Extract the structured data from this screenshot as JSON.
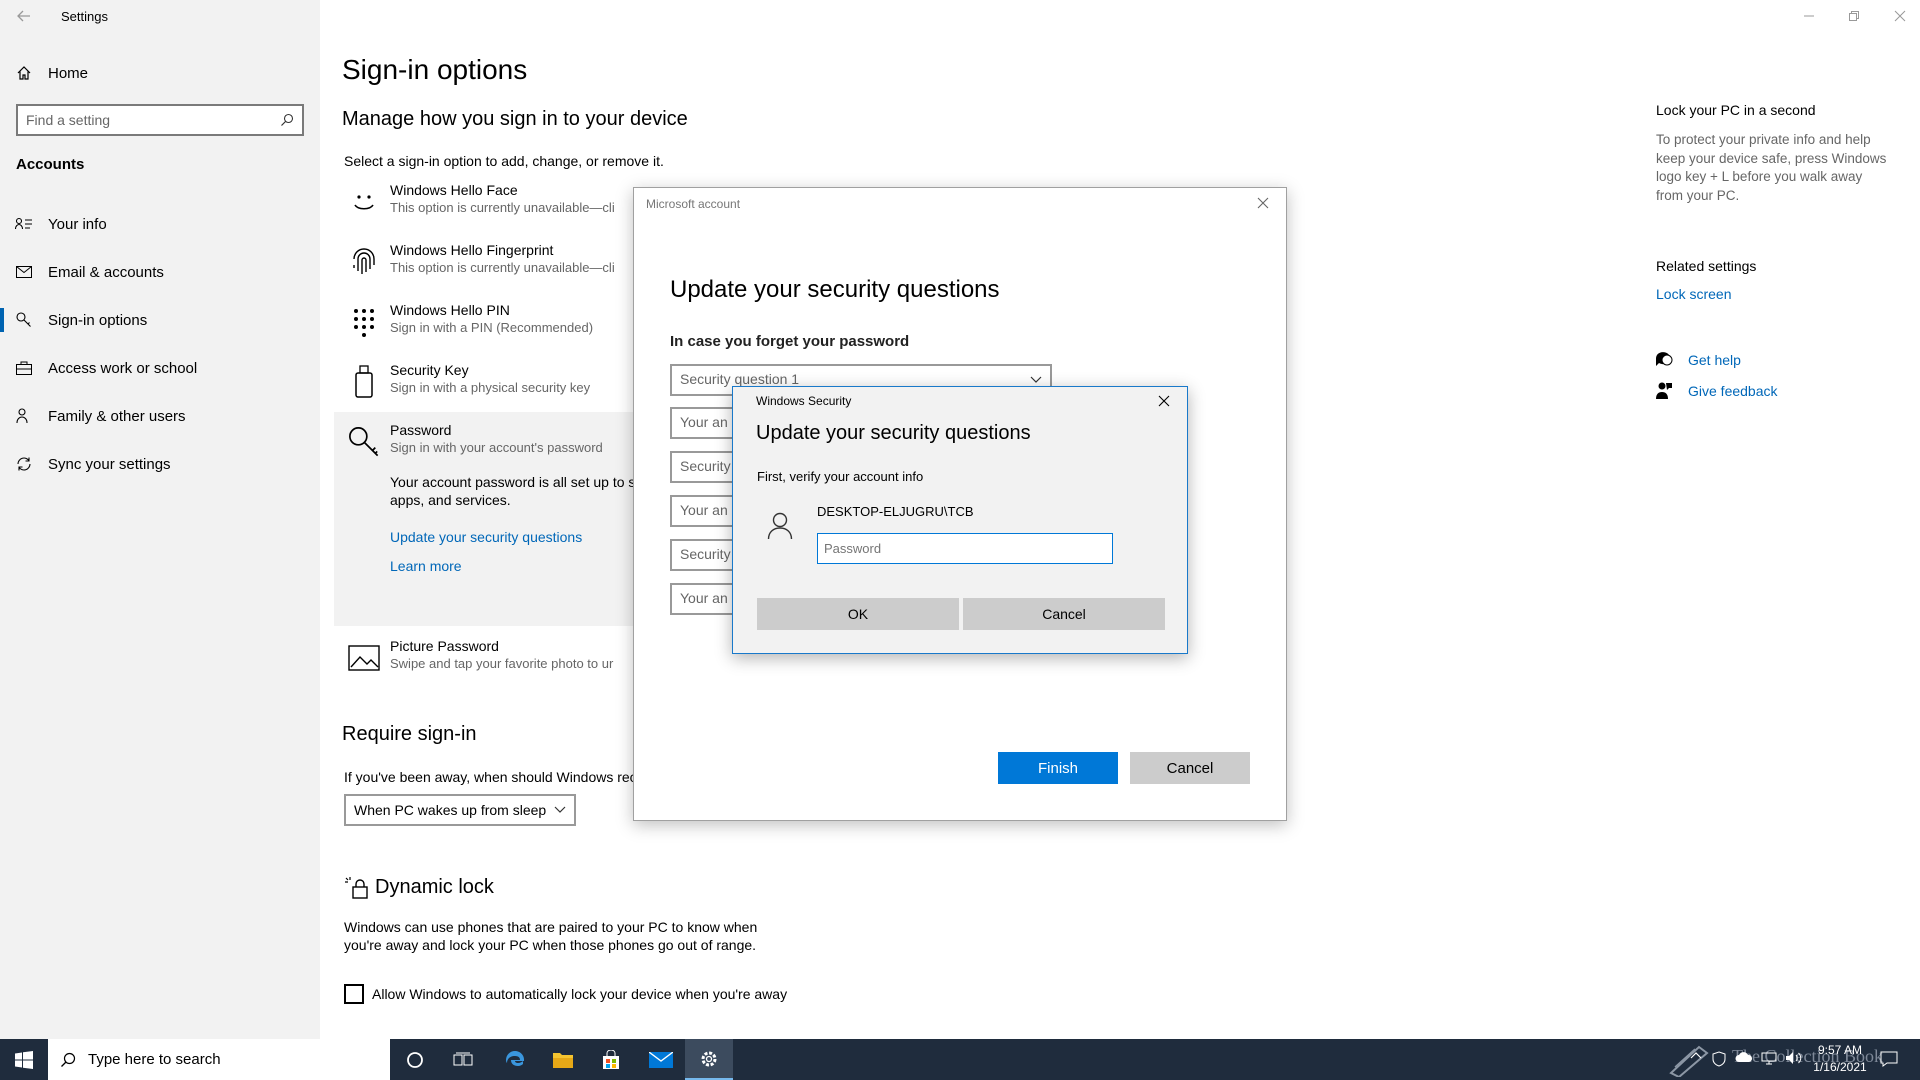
{
  "window": {
    "title": "Settings"
  },
  "sidebar": {
    "home_label": "Home",
    "search_placeholder": "Find a setting",
    "section_title": "Accounts",
    "items": [
      {
        "label": "Your info",
        "icon": "person-card-icon"
      },
      {
        "label": "Email & accounts",
        "icon": "mail-icon"
      },
      {
        "label": "Sign-in options",
        "icon": "key-icon",
        "selected": true
      },
      {
        "label": "Access work or school",
        "icon": "briefcase-icon"
      },
      {
        "label": "Family & other users",
        "icon": "people-icon"
      },
      {
        "label": "Sync your settings",
        "icon": "sync-icon"
      }
    ]
  },
  "main": {
    "title": "Sign-in options",
    "subtitle": "Manage how you sign in to your device",
    "instruction": "Select a sign-in option to add, change, or remove it.",
    "options": [
      {
        "title": "Windows Hello Face",
        "sub": "This option is currently unavailable—cli",
        "icon": "face-icon"
      },
      {
        "title": "Windows Hello Fingerprint",
        "sub": "This option is currently unavailable—cli",
        "icon": "fingerprint-icon"
      },
      {
        "title": "Windows Hello PIN",
        "sub": "Sign in with a PIN (Recommended)",
        "icon": "pin-keypad-icon"
      },
      {
        "title": "Security Key",
        "sub": "Sign in with a physical security key",
        "icon": "usb-key-icon"
      },
      {
        "title": "Password",
        "sub": "Sign in with your account's password",
        "icon": "password-key-icon"
      }
    ],
    "password_detail_line1": "Your account password is all set up to si",
    "password_detail_line2": "apps, and services.",
    "update_security_link": "Update your security questions",
    "learn_more_link": "Learn more",
    "picture_password": {
      "title": "Picture Password",
      "sub": "Swipe and tap your favorite photo to ur"
    },
    "require_signin": {
      "heading": "Require sign-in",
      "text": "If you've been away, when should Windows rec",
      "dropdown_value": "When PC wakes up from sleep"
    },
    "dynamic_lock": {
      "heading": "Dynamic lock",
      "text_line1": "Windows can use phones that are paired to your PC to know when",
      "text_line2": "you're away and lock your PC when those phones go out of range.",
      "checkbox_label": "Allow Windows to automatically lock your device when you're away"
    }
  },
  "right_panel": {
    "lock_heading": "Lock your PC in a second",
    "lock_text_lines": [
      "To protect your private info and help",
      "keep your device safe, press Windows",
      "logo key + L before you walk away",
      "from your PC."
    ],
    "related_heading": "Related settings",
    "lock_screen_link": "Lock screen",
    "get_help": "Get help",
    "give_feedback": "Give feedback"
  },
  "ms_dialog": {
    "title": "Microsoft account",
    "heading": "Update your security questions",
    "subheading": "In case you forget your password",
    "fields": [
      "Security question 1",
      "Your an",
      "Security",
      "Your an",
      "Security",
      "Your an"
    ],
    "finish_label": "Finish",
    "cancel_label": "Cancel"
  },
  "ws_dialog": {
    "title": "Windows Security",
    "heading": "Update your security questions",
    "verify_text": "First, verify your account info",
    "account_name": "DESKTOP-ELJUGRU\\TCB",
    "password_placeholder": "Password",
    "ok_label": "OK",
    "cancel_label": "Cancel"
  },
  "taskbar": {
    "search_placeholder": "Type here to search",
    "time": "9:57 AM",
    "date": "1/16/2021",
    "watermark": "The Collection Book"
  }
}
